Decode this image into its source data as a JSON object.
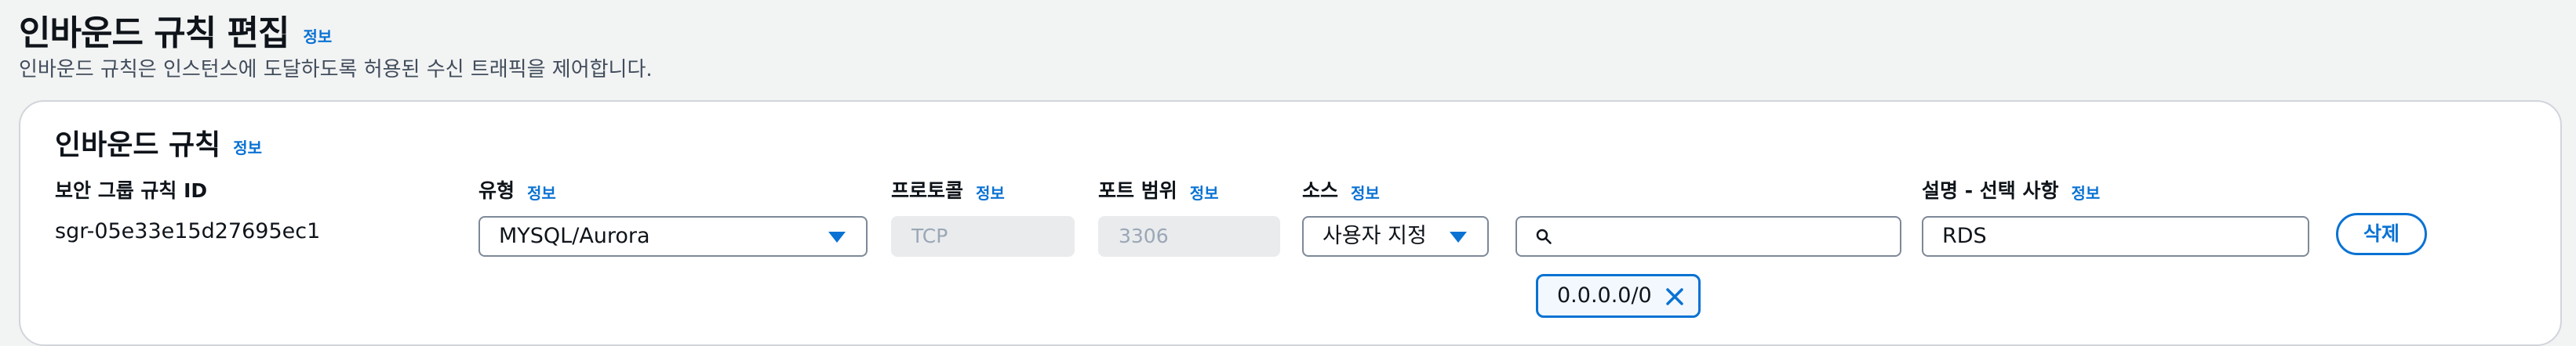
{
  "header": {
    "title": "인바운드 규칙 편집",
    "info": "정보",
    "description": "인바운드 규칙은 인스턴스에 도달하도록 허용된 수신 트래픽을 제어합니다."
  },
  "section": {
    "title": "인바운드 규칙",
    "info": "정보"
  },
  "columns": {
    "rule_id": "보안 그룹 규칙 ID",
    "type": "유형",
    "protocol": "프로토콜",
    "port_range": "포트 범위",
    "source": "소스",
    "description": "설명 - 선택 사항",
    "info": "정보"
  },
  "rule": {
    "id": "sgr-05e33e15d27695ec1",
    "type": "MYSQL/Aurora",
    "protocol": "TCP",
    "port_range": "3306",
    "source_type": "사용자 지정",
    "source_search_value": "",
    "source_token": "0.0.0.0/0",
    "description": "RDS",
    "delete_label": "삭제"
  },
  "colors": {
    "accent": "#0972d3",
    "page_bg": "#f2f3f3",
    "disabled_bg": "#e9ebed"
  }
}
